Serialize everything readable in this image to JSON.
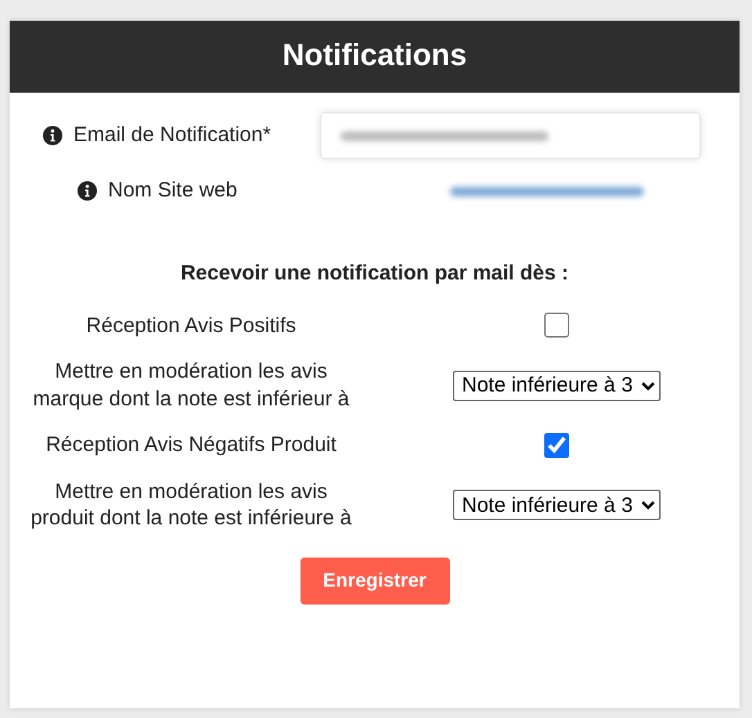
{
  "title": "Notifications",
  "info_fields": [
    {
      "kind": "input",
      "label": "Email de Notification*"
    },
    {
      "kind": "link",
      "label": "Nom Site web"
    }
  ],
  "section_heading": "Recevoir une notification par mail dès :",
  "settings": [
    {
      "kind": "checkbox",
      "label": "Réception Avis Positifs",
      "checked": false
    },
    {
      "kind": "select",
      "label": "Mettre en modération les avis marque dont la note est inférieur à",
      "value": "Note inférieure à 3"
    },
    {
      "kind": "checkbox",
      "label": "Réception Avis Négatifs Produit",
      "checked": true
    },
    {
      "kind": "select",
      "label": "Mettre en modération les avis produit dont la note est inférieure à",
      "value": "Note inférieure à 3"
    }
  ],
  "save_button": "Enregistrer"
}
